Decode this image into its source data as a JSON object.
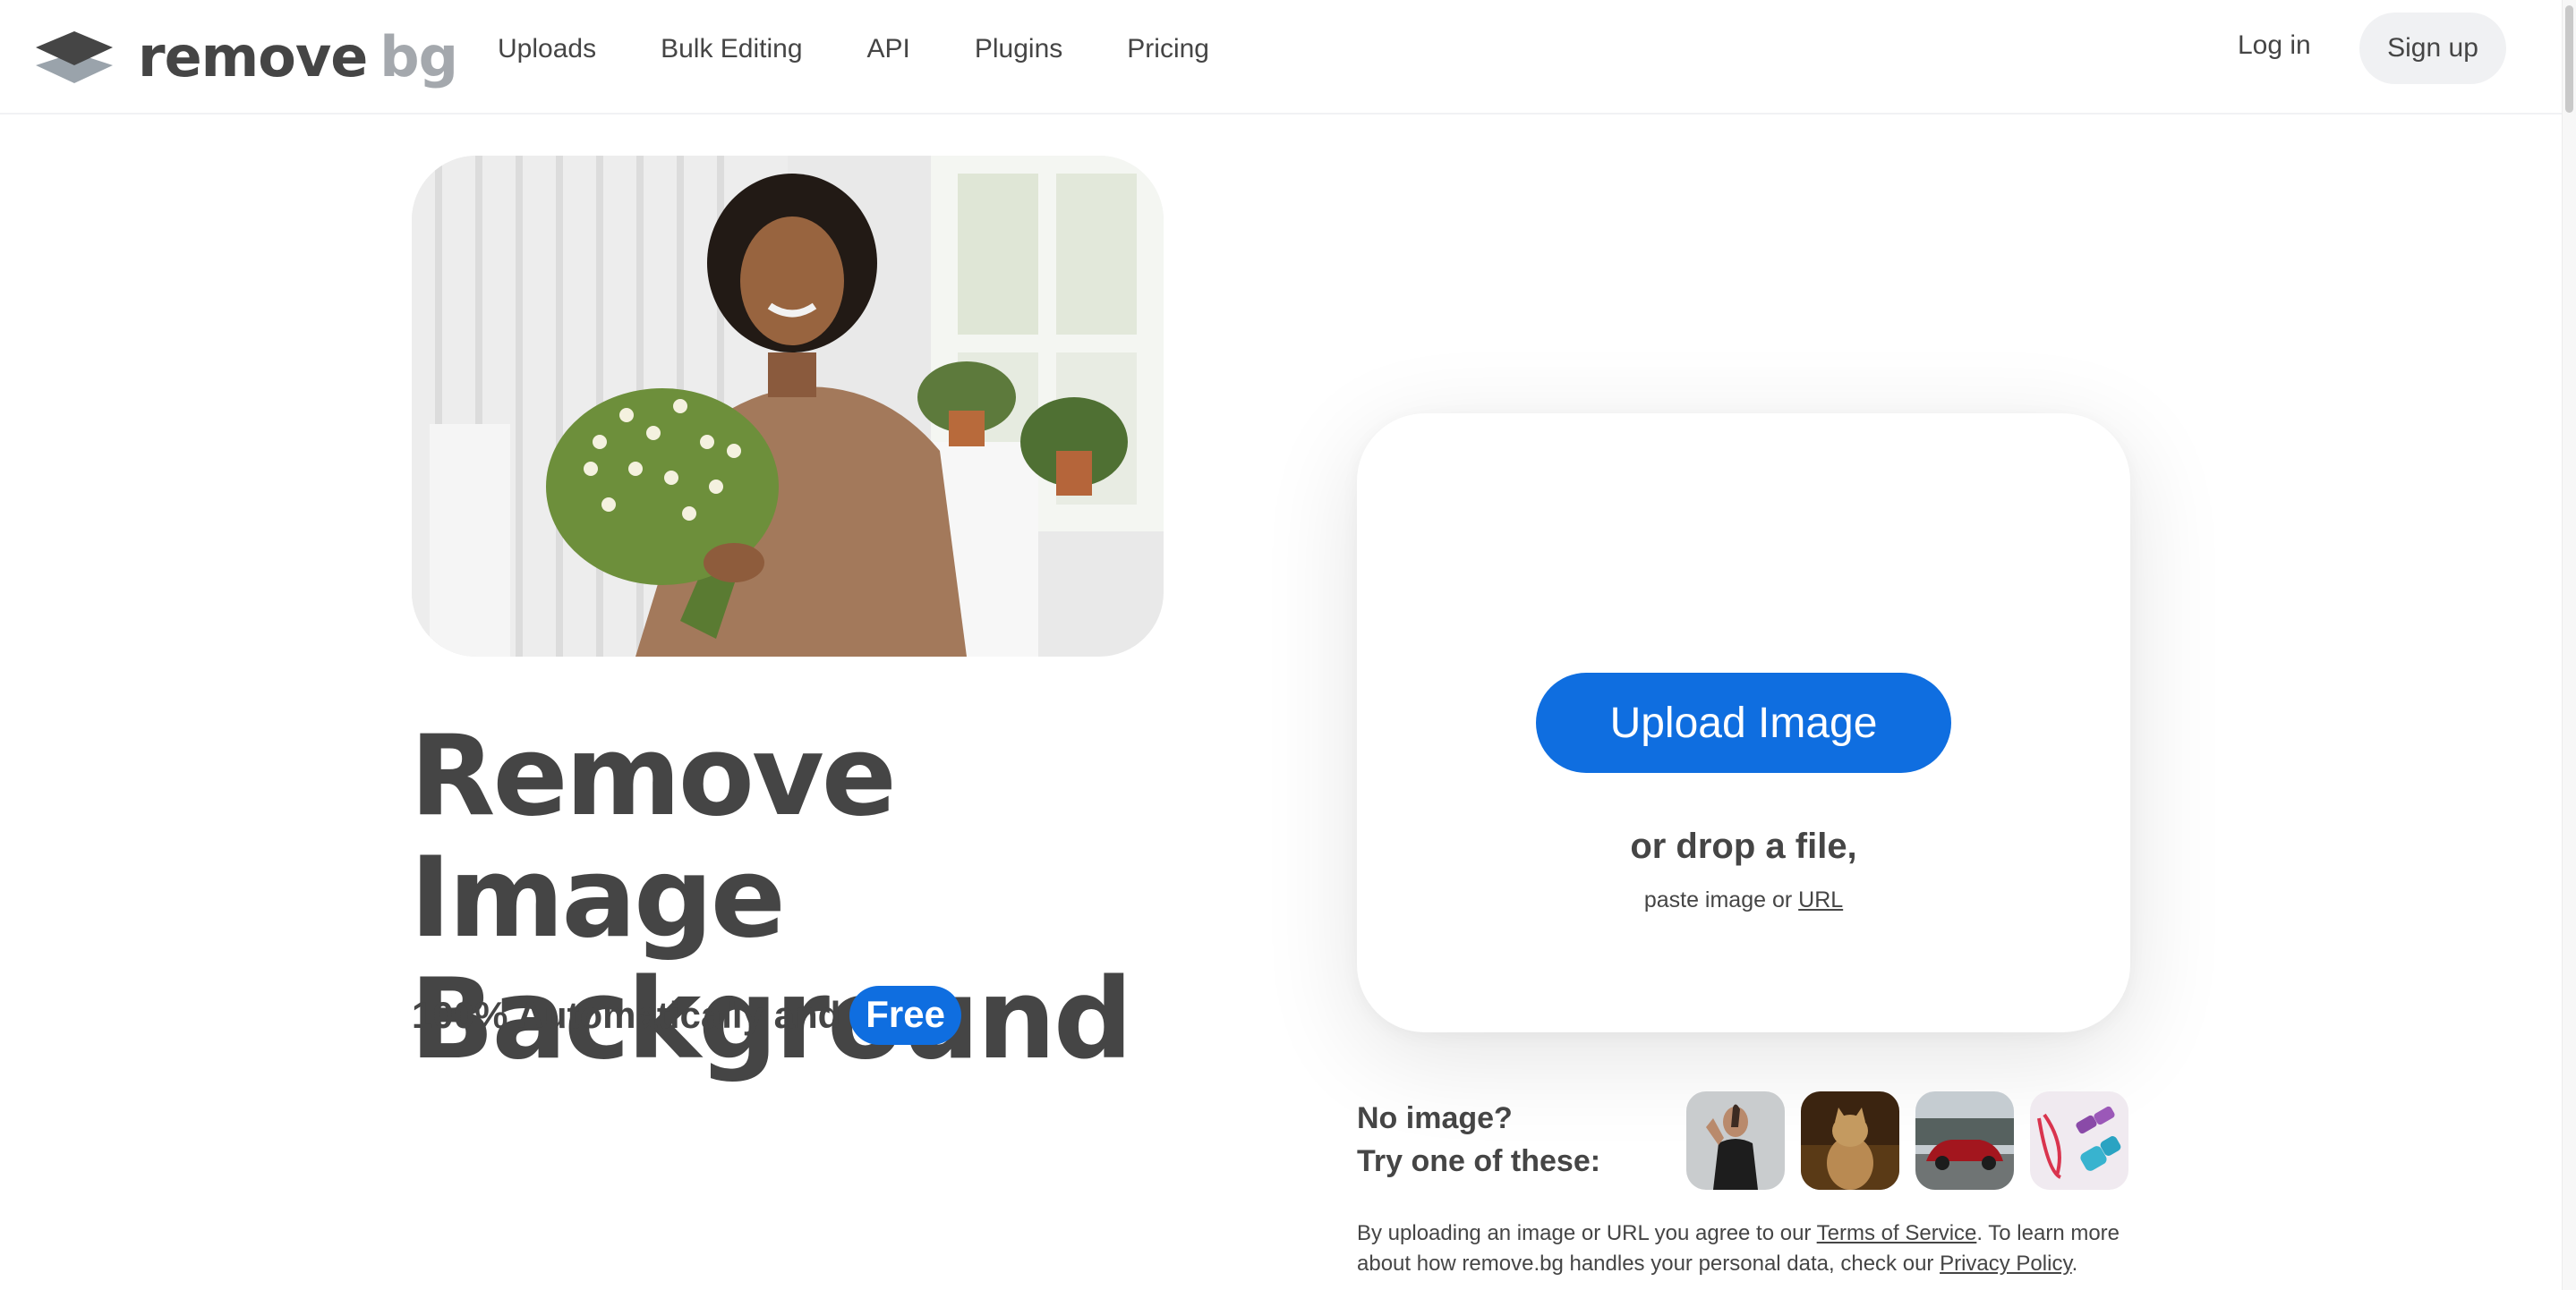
{
  "header": {
    "logo": {
      "word1": "remove",
      "word2": "bg",
      "icon": "layers-logo-icon"
    },
    "nav": [
      "Uploads",
      "Bulk Editing",
      "API",
      "Plugins",
      "Pricing"
    ],
    "login": "Log in",
    "signup": "Sign up"
  },
  "hero": {
    "image_alt": "Woman holding a bouquet of daisies",
    "title_line1": "Remove Image",
    "title_line2": "Background",
    "subtitle": "100% Automatically and",
    "badge": "Free"
  },
  "upload": {
    "button": "Upload Image",
    "drop": "or drop a file,",
    "paste_prefix": "paste image or",
    "paste_link": "URL"
  },
  "samples": {
    "line1": "No image?",
    "line2": "Try one of these:",
    "items": [
      "Woman flexing arm",
      "Cat",
      "Red car",
      "Fitness equipment"
    ]
  },
  "legal": {
    "part1": "By uploading an image or URL you agree to our",
    "tos": "Terms of Service",
    "part2": ". To learn more about how remove.bg handles your personal data, check our",
    "privacy": "Privacy Policy",
    "part3": "."
  },
  "colors": {
    "accent": "#0f6ee0",
    "text": "#454545",
    "muted": "#a4a8ad"
  }
}
